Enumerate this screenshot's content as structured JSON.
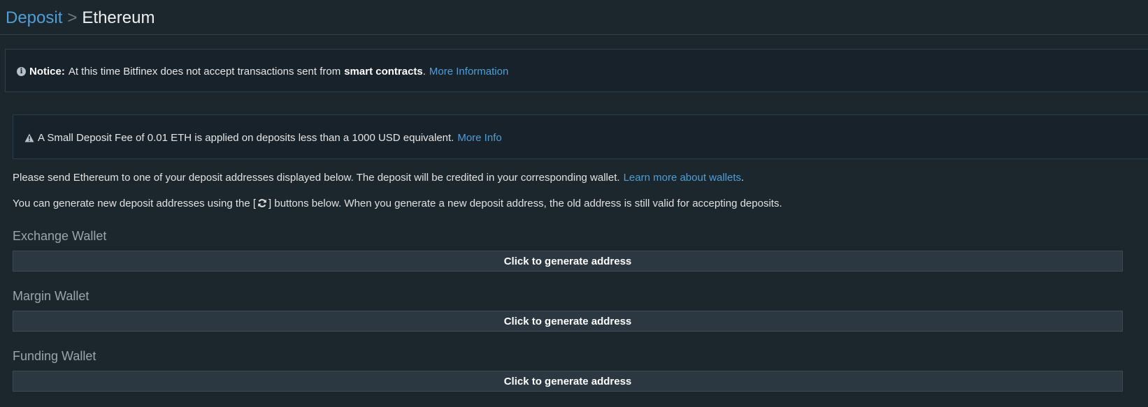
{
  "breadcrumb": {
    "parent": "Deposit",
    "separator": ">",
    "current": "Ethereum"
  },
  "notice": {
    "icon": "info-circle-icon",
    "label": "Notice:",
    "text_before": "At this time Bitfinex does not accept transactions sent from",
    "bold_text": "smart contracts",
    "text_after": ".",
    "link": "More Information"
  },
  "fee_notice": {
    "icon": "warning-triangle-icon",
    "text": "A Small Deposit Fee of 0.01 ETH is applied on deposits less than a 1000 USD equivalent.",
    "link": "More Info"
  },
  "instructions": {
    "line1_text": "Please send Ethereum to one of your deposit addresses displayed below. The deposit will be credited in your corresponding wallet.",
    "line1_link": "Learn more about wallets",
    "line1_end": ".",
    "line2_before": "You can generate new deposit addresses using the [",
    "line2_icon": "refresh-icon",
    "line2_after": "] buttons below. When you generate a new deposit address, the old address is still valid for accepting deposits."
  },
  "wallets": [
    {
      "label": "Exchange Wallet",
      "button": "Click to generate address"
    },
    {
      "label": "Margin Wallet",
      "button": "Click to generate address"
    },
    {
      "label": "Funding Wallet",
      "button": "Click to generate address"
    }
  ],
  "colors": {
    "background": "#1b262d",
    "link": "#4f9fd6",
    "notice_border": "#2c4150",
    "button_bg": "#2c3841"
  }
}
